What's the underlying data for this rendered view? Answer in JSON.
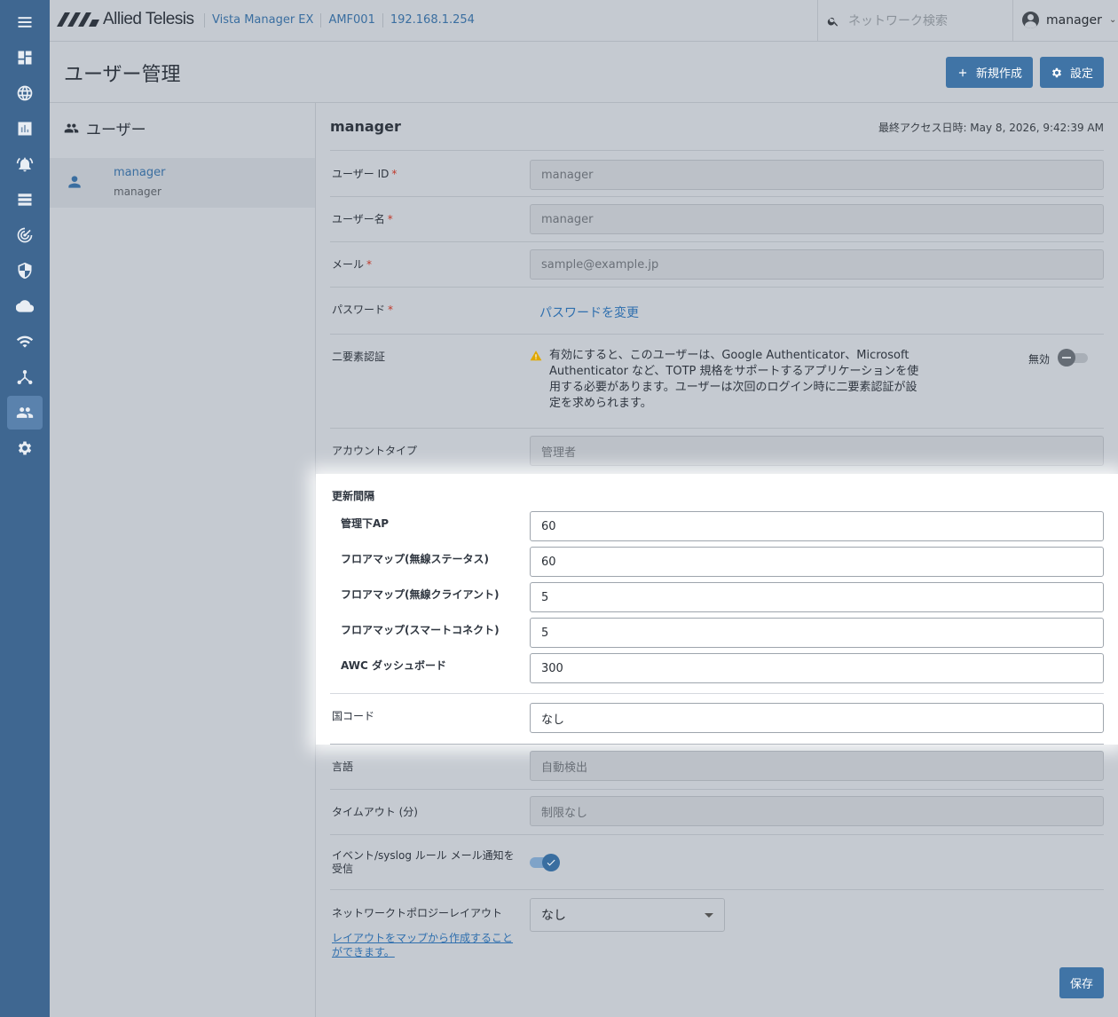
{
  "brand": {
    "logo_text": "Allied Telesis"
  },
  "breadcrumb": [
    "Vista Manager EX",
    "AMF001",
    "192.168.1.254"
  ],
  "search": {
    "placeholder": "ネットワーク検索"
  },
  "user_menu": {
    "name": "manager"
  },
  "rail": {
    "items": [
      "menu-icon",
      "dashboard-icon",
      "globe-icon",
      "chart-icon",
      "alarm-icon",
      "list-icon",
      "radar-icon",
      "shield-icon",
      "cloud-icon",
      "wifi-icon",
      "topology-icon",
      "users-icon",
      "gear-icon"
    ],
    "active": "users-icon"
  },
  "page": {
    "title": "ユーザー管理",
    "new_button": "新規作成",
    "settings_button": "設定"
  },
  "user_list": {
    "heading": "ユーザー",
    "items": [
      {
        "name": "manager",
        "sub": "manager"
      }
    ]
  },
  "detail": {
    "title": "manager",
    "last_access": "最終アクセス日時: May 8, 2026, 9:42:39 AM",
    "user_id": {
      "label": "ユーザー ID",
      "req": "*",
      "value": "manager"
    },
    "user_name": {
      "label": "ユーザー名",
      "req": "*",
      "value": "manager"
    },
    "email": {
      "label": "メール",
      "req": "*",
      "value": "sample@example.jp"
    },
    "password": {
      "label": "パスワード",
      "req": "*",
      "link": "パスワードを変更"
    },
    "two_factor": {
      "label": "二要素認証",
      "warning": "有効にすると、このユーザーは、Google Authenticator、Microsoft Authenticator など、TOTP 規格をサポートするアプリケーションを使用する必要があります。ユーザーは次回のログイン時に二要素認証が設定を求められます。",
      "state_label": "無効"
    },
    "account_type": {
      "label": "アカウントタイプ",
      "value": "管理者"
    },
    "refresh": {
      "heading": "更新間隔",
      "items": [
        {
          "label": "管理下AP",
          "value": "60"
        },
        {
          "label": "フロアマップ(無線ステータス)",
          "value": "60"
        },
        {
          "label": "フロアマップ(無線クライアント)",
          "value": "5"
        },
        {
          "label": "フロアマップ(スマートコネクト)",
          "value": "5"
        },
        {
          "label": "AWC ダッシュボード",
          "value": "300"
        }
      ]
    },
    "country": {
      "label": "国コード",
      "value": "なし"
    },
    "language": {
      "label": "言語",
      "value": "自動検出"
    },
    "timeout": {
      "label": "タイムアウト (分)",
      "value": "制限なし"
    },
    "event_notify": {
      "label": "イベント/syslog ルール メール通知を受信",
      "enabled": true
    },
    "topology": {
      "label": "ネットワークトポロジーレイアウト",
      "value": "なし",
      "link": "レイアウトをマップから作成することができます。"
    },
    "save_button": "保存"
  },
  "colors": {
    "accent": "#4074a6",
    "rail": "#3f6791",
    "link": "#2f6fae",
    "warning": "#e0a800"
  }
}
